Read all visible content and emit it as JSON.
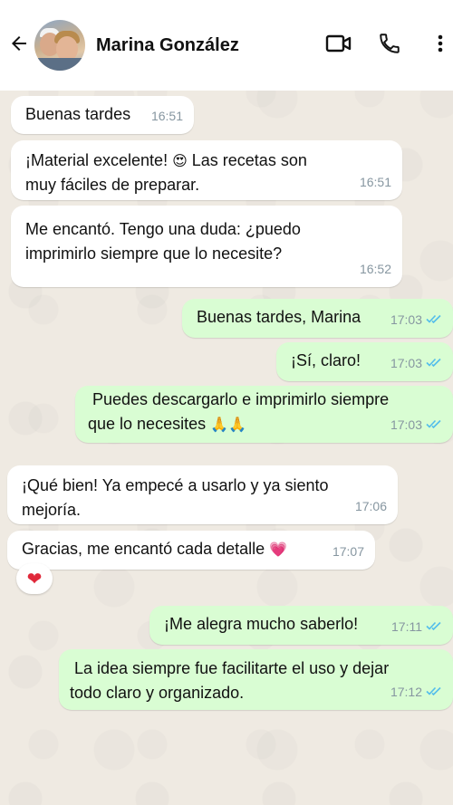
{
  "contact": {
    "name": "Marina González"
  },
  "icons": {
    "back": "arrow-left-icon",
    "video": "video-camera-icon",
    "call": "phone-icon",
    "more": "more-vertical-icon",
    "read": "double-check-icon"
  },
  "colors": {
    "incoming_bubble": "#ffffff",
    "outgoing_bubble": "#d9fdd3",
    "read_ticks": "#53bdeb",
    "timestamp": "#8696a0"
  },
  "messages": [
    {
      "direction": "in",
      "text": "Buenas tardes",
      "time": "16:51"
    },
    {
      "direction": "in",
      "text_line1": "¡Material excelente! ",
      "emoji": "😍",
      "text_line1b": " Las recetas son",
      "text_line2": "muy fáciles de preparar.",
      "time": "16:51"
    },
    {
      "direction": "in",
      "text_line1": "Me encantó. Tengo una duda: ¿puedo",
      "text_line2": "imprimirlo siempre que lo necesite?",
      "time": "16:52"
    },
    {
      "direction": "out",
      "text": "Buenas tardes, Marina",
      "time": "17:03",
      "status": "read"
    },
    {
      "direction": "out",
      "text": "¡Sí, claro!",
      "time": "17:03",
      "status": "read"
    },
    {
      "direction": "out",
      "text_line1": " Puedes descargarlo e imprimirlo siempre",
      "text_line2": "que lo necesites ",
      "emoji": "🙏🙏",
      "time": "17:03",
      "status": "read"
    },
    {
      "direction": "in",
      "text_line1": "¡Qué bien! Ya empecé a usarlo y ya siento",
      "text_line2": "mejoría.",
      "time": "17:06"
    },
    {
      "direction": "in",
      "text": "Gracias, me encantó cada detalle ",
      "emoji": "💗",
      "time": "17:07",
      "reaction": "❤"
    },
    {
      "direction": "out",
      "text": "¡Me alegra mucho saberlo!",
      "time": "17:11",
      "status": "read"
    },
    {
      "direction": "out",
      "text_line1": " La idea siempre fue facilitarte el uso y dejar",
      "text_line2": "todo claro y organizado.",
      "time": "17:12",
      "status": "read"
    }
  ]
}
